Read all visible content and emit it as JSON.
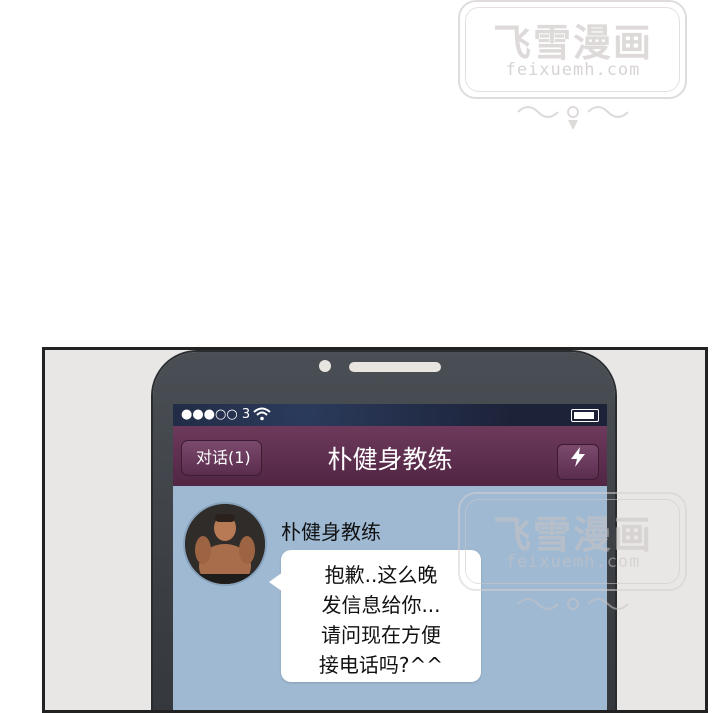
{
  "watermark": {
    "title": "飞雪漫画",
    "url": "feixuemh.com"
  },
  "status_bar": {
    "carrier": "●●●○○ 3",
    "wifi_icon": "wifi-icon",
    "battery_icon": "battery-icon"
  },
  "nav": {
    "back_label": "对话(1)",
    "title": "朴健身教练",
    "action_icon": "lightning-icon"
  },
  "message": {
    "sender": "朴健身教练",
    "lines": [
      "抱歉..这么晚",
      "发信息给你...",
      "请问现在方便",
      "接电话吗?^^"
    ]
  },
  "colors": {
    "nav_bar": "#5e2d50",
    "screen_bg": "#9fb9d3",
    "phone_body": "#3f4348"
  }
}
